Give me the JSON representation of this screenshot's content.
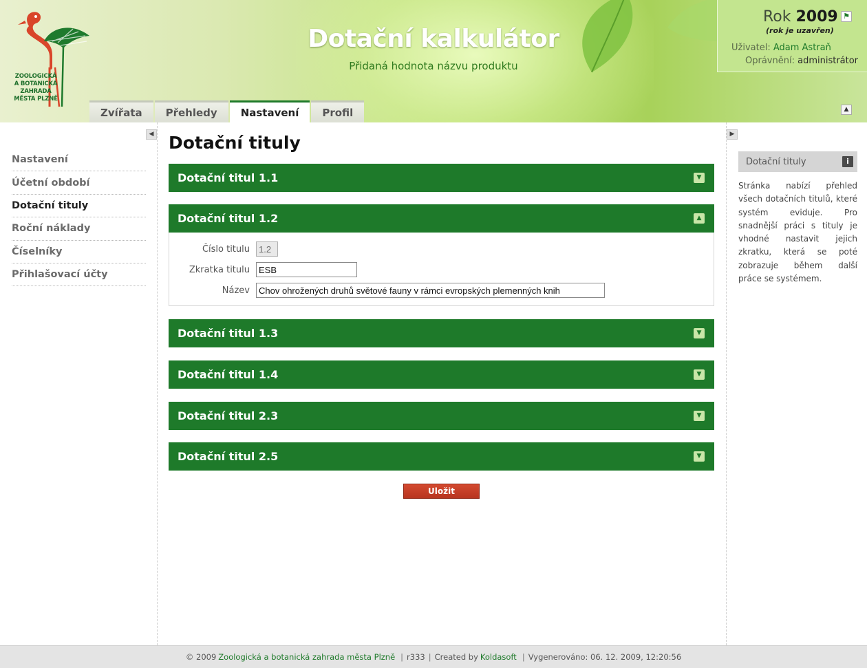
{
  "header": {
    "logo_lines": [
      "ZOOLOGICKÁ",
      "A BOTANICKÁ",
      "ZAHRADA",
      "MĚSTA PLZNĚ"
    ],
    "title": "Dotační kalkulátor",
    "subtitle": "Přidaná hodnota názvu produktu"
  },
  "tabs": [
    {
      "label": "Zvířata"
    },
    {
      "label": "Přehledy"
    },
    {
      "label": "Nastavení",
      "active": true
    },
    {
      "label": "Profil"
    }
  ],
  "yearbox": {
    "prefix": "Rok",
    "year": "2009",
    "note": "(rok je uzavřen)",
    "user_label": "Uživatel:",
    "user_value": "Adam Astraň",
    "role_label": "Oprávnění:",
    "role_value": "administrátor"
  },
  "sidebar": {
    "items": [
      {
        "label": "Nastavení"
      },
      {
        "label": "Účetní období"
      },
      {
        "label": "Dotační tituly",
        "active": true
      },
      {
        "label": "Roční náklady"
      },
      {
        "label": "Číselníky"
      },
      {
        "label": "Přihlašovací účty"
      }
    ]
  },
  "main": {
    "title": "Dotační tituly",
    "panels": [
      {
        "title": "Dotační titul 1.1",
        "expanded": false
      },
      {
        "title": "Dotační titul 1.2",
        "expanded": true
      },
      {
        "title": "Dotační titul 1.3",
        "expanded": false
      },
      {
        "title": "Dotační titul 1.4",
        "expanded": false
      },
      {
        "title": "Dotační titul 2.3",
        "expanded": false
      },
      {
        "title": "Dotační titul 2.5",
        "expanded": false
      }
    ],
    "form": {
      "number_label": "Číslo titulu",
      "number_value": "1.2",
      "abbr_label": "Zkratka titulu",
      "abbr_value": "ESB",
      "name_label": "Název",
      "name_value": "Chov ohrožených druhů světové fauny v rámci evropských plemenných knih"
    },
    "save_label": "Uložit"
  },
  "help": {
    "title": "Dotační tituly",
    "text": "Stránka nabízí přehled všech dotačních titulů, které systém eviduje. Pro snadnější práci s tituly je vhodné nastavit jejich zkratku, která se poté zobrazuje během další práce se systémem."
  },
  "footer": {
    "copyright": "© 2009",
    "org_link": "Zoologická a botanická zahrada města Plzně",
    "revision": "r333",
    "created_by": "Created by",
    "company_link": "Koldasoft",
    "generated": "Vygenerováno: 06. 12. 2009, 12:20:56"
  },
  "colors": {
    "primary_green": "#1e7a2a",
    "save_red": "#c03a22",
    "header_lime": "#b7dc6e"
  },
  "icons": {
    "chevron_collapsed": "chevron-down-icon",
    "chevron_expanded": "chevron-up-icon",
    "info": "info-icon",
    "close_year": "running-man-icon"
  }
}
